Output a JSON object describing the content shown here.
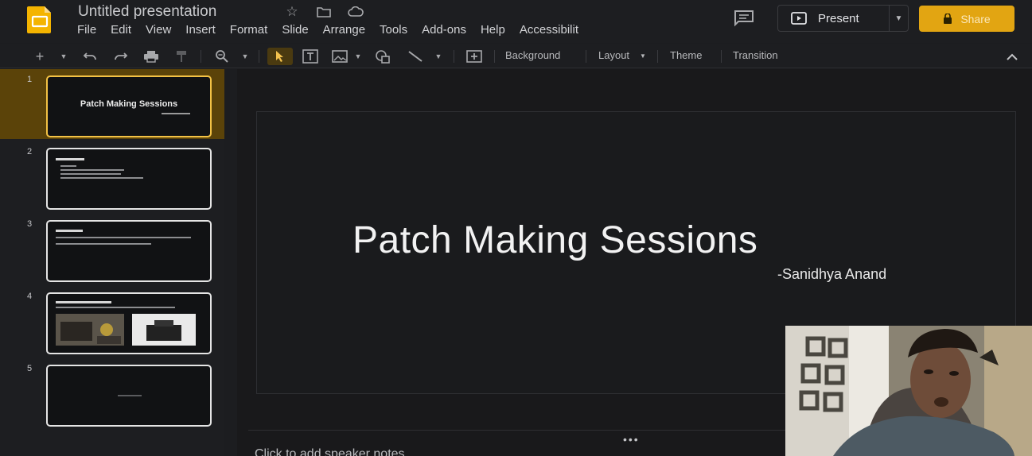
{
  "app": {
    "title": "Untitled presentation",
    "menu": [
      "File",
      "Edit",
      "View",
      "Insert",
      "Format",
      "Slide",
      "Arrange",
      "Tools",
      "Add-ons",
      "Help",
      "Accessibilit"
    ],
    "present_label": "Present",
    "share_label": "Share",
    "accent": "#e2a512"
  },
  "toolbar": {
    "background_label": "Background",
    "layout_label": "Layout",
    "theme_label": "Theme",
    "transition_label": "Transition"
  },
  "slides": [
    {
      "number": "1",
      "title": "Patch Making Sessions"
    },
    {
      "number": "2",
      "title": ""
    },
    {
      "number": "3",
      "title": ""
    },
    {
      "number": "4",
      "title": ""
    },
    {
      "number": "5",
      "title": ""
    }
  ],
  "current_slide": {
    "title": "Patch Making Sessions",
    "subtitle": "-Sanidhya Anand"
  },
  "notes": {
    "placeholder": "Click to add speaker notes"
  }
}
